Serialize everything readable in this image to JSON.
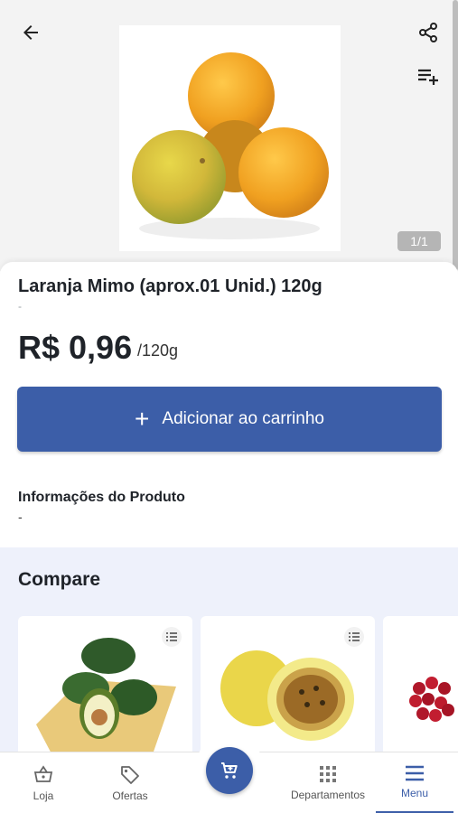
{
  "header": {
    "back_icon": "arrow-left-icon",
    "share_icon": "share-icon",
    "add_to_list_icon": "playlist-add-icon",
    "image_counter": "1/1"
  },
  "product": {
    "name": "Laranja Mimo (aprox.01 Unid.) 120g",
    "brand": "-",
    "price": "R$ 0,96",
    "unit": "/120g",
    "add_to_cart_label": "Adicionar ao carrinho",
    "info_title": "Informações do Produto",
    "info_text": "-"
  },
  "compare": {
    "title": "Compare",
    "cards": [
      {
        "image": "avocado-image"
      },
      {
        "image": "passion-fruit-image"
      },
      {
        "image": "grapes-image"
      }
    ]
  },
  "bottom_nav": {
    "items": [
      {
        "label": "Loja",
        "icon": "basket-icon"
      },
      {
        "label": "Ofertas",
        "icon": "tag-icon"
      },
      {
        "label": "Departamentos",
        "icon": "grid-icon"
      },
      {
        "label": "Menu",
        "icon": "menu-icon"
      }
    ],
    "cart_icon": "cart-icon"
  },
  "colors": {
    "primary": "#3c5ea8",
    "compare_bg": "#eef1fb",
    "text": "#1f2329"
  }
}
